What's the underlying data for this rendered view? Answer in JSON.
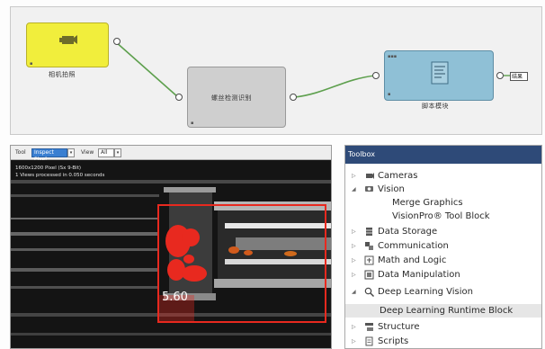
{
  "graph": {
    "camera_node_label": "相机拍照",
    "detect_node_label": "螺丝检测识别",
    "script_node_label": "脚本模块",
    "output_node_label": "结果",
    "node_colors": {
      "camera": "#f1ee3c",
      "detect": "#cfcfcf",
      "script": "#8fc0d6",
      "wire": "#5ea04e"
    }
  },
  "viewer": {
    "tool_label": "Tool",
    "tool_value": "Inspect Pixel",
    "view_label": "View",
    "view_value": "All",
    "info_line_1": "1600x1200 Pixel (Sx 9-Bit)",
    "info_line_2": "1 Views processed in 0.050 seconds",
    "score": "5.60",
    "overlay_color": "#e8291f"
  },
  "toolbox": {
    "title": "Toolbox",
    "items": [
      {
        "label": "Cameras",
        "expander": "▷",
        "icon": "camera-icon"
      },
      {
        "label": "Vision",
        "expander": "◢",
        "icon": "vision-icon"
      },
      {
        "label": "Merge Graphics",
        "expander": "",
        "icon": ""
      },
      {
        "label": "VisionPro® Tool Block",
        "expander": "",
        "icon": ""
      },
      {
        "label": "Data Storage",
        "expander": "▷",
        "icon": "data-storage-icon"
      },
      {
        "label": "Communication",
        "expander": "▷",
        "icon": "communication-icon"
      },
      {
        "label": "Math and Logic",
        "expander": "▷",
        "icon": "math-logic-icon"
      },
      {
        "label": "Data Manipulation",
        "expander": "▷",
        "icon": "data-manipulation-icon"
      },
      {
        "label": "Deep Learning Vision",
        "expander": "◢",
        "icon": "deep-learning-icon"
      },
      {
        "label": "Deep Learning Runtime Block",
        "expander": "",
        "icon": ""
      },
      {
        "label": "Structure",
        "expander": "▷",
        "icon": "structure-icon"
      },
      {
        "label": "Scripts",
        "expander": "▷",
        "icon": "scripts-icon"
      }
    ]
  }
}
